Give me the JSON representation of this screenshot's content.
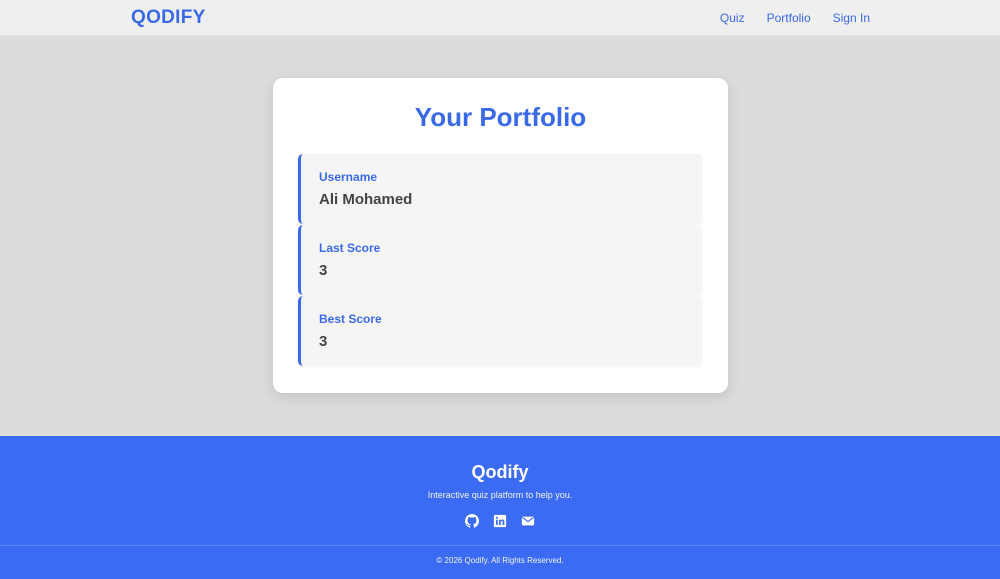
{
  "navbar": {
    "brand": "QODIFY",
    "links": [
      "Quiz",
      "Portfolio",
      "Sign In"
    ]
  },
  "portfolio": {
    "title": "Your Portfolio",
    "items": [
      {
        "label": "Username",
        "value": "Ali Mohamed"
      },
      {
        "label": "Last Score",
        "value": "3"
      },
      {
        "label": "Best Score",
        "value": "3"
      }
    ]
  },
  "footer": {
    "brand": "Qodify",
    "tagline": "Interactive quiz platform to help you.",
    "social_icons": [
      "github-icon",
      "linkedin-icon",
      "envelope-icon"
    ],
    "copyright": "© 2026 Qodify. All Rights Reserved."
  },
  "colors": {
    "accent": "#3b6ae8",
    "footer_bg": "#3b6bf2",
    "page_bg": "#dddcdc",
    "navbar_bg": "#efefef"
  }
}
